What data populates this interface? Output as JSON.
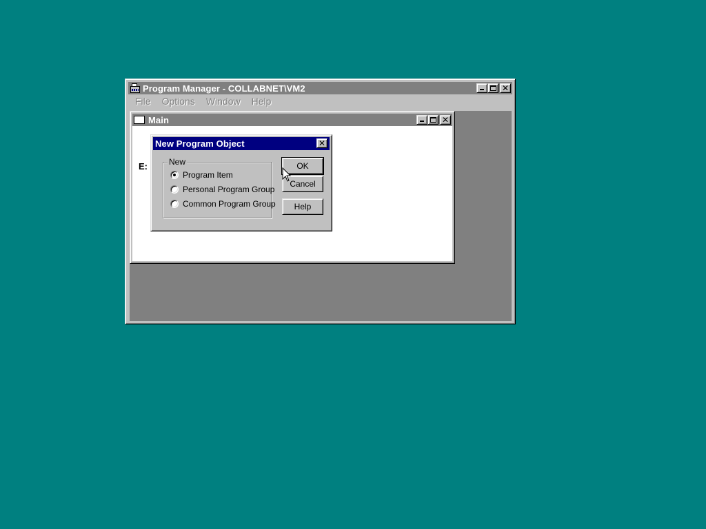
{
  "desktop": {
    "background": "#008080"
  },
  "program_manager": {
    "title": "Program Manager - COLLABNET\\VM2",
    "icon": "program-manager-icon",
    "menu": [
      "File",
      "Options",
      "Window",
      "Help"
    ],
    "caption_buttons": [
      "minimize-icon",
      "maximize-icon",
      "close-icon"
    ]
  },
  "main_group": {
    "title": "Main",
    "partial_item_label": "E:"
  },
  "dialog": {
    "title": "New Program Object",
    "group_label": "New",
    "options": [
      {
        "label": "Program Item",
        "selected": true
      },
      {
        "label": "Personal Program Group",
        "selected": false
      },
      {
        "label": "Common Program Group",
        "selected": false
      }
    ],
    "buttons": {
      "ok": "OK",
      "cancel": "Cancel",
      "help": "Help"
    }
  },
  "colors": {
    "active_title": "#000080",
    "inactive_title": "#808080",
    "face": "#c0c0c0"
  }
}
